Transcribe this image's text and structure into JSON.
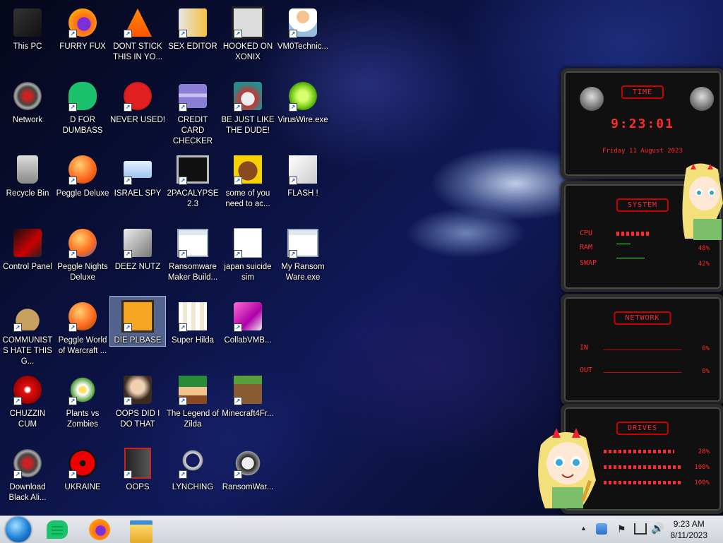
{
  "icons": [
    {
      "label": "This PC",
      "col": 0,
      "row": 0,
      "icon": "this-pc-icon"
    },
    {
      "label": "FURRY FUX",
      "col": 1,
      "row": 0,
      "icon": "firefox-icon"
    },
    {
      "label": "DONT STICK THIS IN YO...",
      "col": 2,
      "row": 0,
      "icon": "vlc-cone-icon"
    },
    {
      "label": "SEX EDITOR",
      "col": 3,
      "row": 0,
      "icon": "hxd-icon"
    },
    {
      "label": "HOOKED ON XONIX",
      "col": 4,
      "row": 0,
      "icon": "xonix-icon"
    },
    {
      "label": "VM0Technic...",
      "col": 5,
      "row": 0,
      "icon": "doctor-icon"
    },
    {
      "label": "Network",
      "col": 0,
      "row": 1,
      "icon": "alien-network-icon"
    },
    {
      "label": "D FOR DUMBASS",
      "col": 1,
      "row": 1,
      "icon": "d-app-icon"
    },
    {
      "label": "NEVER USED!",
      "col": 2,
      "row": 1,
      "icon": "dev-cpp-icon"
    },
    {
      "label": "CREDIT CARD CHECKER",
      "col": 3,
      "row": 1,
      "icon": "credit-card-icon"
    },
    {
      "label": "BE JUST LIKE THE DUDE!",
      "col": 4,
      "row": 1,
      "icon": "santa-icon"
    },
    {
      "label": "VirusWire.exe",
      "col": 5,
      "row": 1,
      "icon": "lime-icon"
    },
    {
      "label": "Recycle Bin",
      "col": 0,
      "row": 2,
      "icon": "recycle-bin-icon"
    },
    {
      "label": "Peggle Deluxe",
      "col": 1,
      "row": 2,
      "icon": "peggle-icon"
    },
    {
      "label": "ISRAEL SPY",
      "col": 2,
      "row": 2,
      "icon": "network-share-icon"
    },
    {
      "label": "2PACALYPSE 2.3",
      "col": 3,
      "row": 2,
      "icon": "terminal-icon"
    },
    {
      "label": "some of you need to ac...",
      "col": 4,
      "row": 2,
      "icon": "dog-icon"
    },
    {
      "label": "FLASH !",
      "col": 5,
      "row": 2,
      "icon": "flash-icon"
    },
    {
      "label": "Control Panel",
      "col": 0,
      "row": 3,
      "icon": "control-panel-icon"
    },
    {
      "label": "Peggle Nights Deluxe",
      "col": 1,
      "row": 3,
      "icon": "peggle-nights-icon"
    },
    {
      "label": "DEEZ NUTZ",
      "col": 2,
      "row": 3,
      "icon": "stack-windows-icon"
    },
    {
      "label": "Ransomware Maker Build...",
      "col": 3,
      "row": 3,
      "icon": "window-app-icon"
    },
    {
      "label": "japan suicide sim",
      "col": 4,
      "row": 3,
      "icon": "document-icon"
    },
    {
      "label": "My Ransom Ware.exe",
      "col": 5,
      "row": 3,
      "icon": "window-app-icon"
    },
    {
      "label": "COMMUNISTS HATE THIS G...",
      "col": 0,
      "row": 4,
      "icon": "money-bag-icon"
    },
    {
      "label": "Peggle World of Warcraft ...",
      "col": 1,
      "row": 4,
      "icon": "peggle-wow-icon"
    },
    {
      "label": "DIE PLBASE",
      "col": 2,
      "row": 4,
      "icon": "dreamweaver-icon",
      "selected": true
    },
    {
      "label": "Super Hilda",
      "col": 3,
      "row": 4,
      "icon": "pixel-hilda-icon"
    },
    {
      "label": "CollabVMB...",
      "col": 4,
      "row": 4,
      "icon": "collabvm-icon"
    },
    {
      "label": "CHUZZIN CUM",
      "col": 0,
      "row": 5,
      "icon": "chuzzle-icon"
    },
    {
      "label": "Plants vs Zombies",
      "col": 1,
      "row": 5,
      "icon": "flower-icon"
    },
    {
      "label": "OOPS DID I DO THAT",
      "col": 2,
      "row": 5,
      "icon": "portrait-icon"
    },
    {
      "label": "The Legend of Zilda",
      "col": 3,
      "row": 5,
      "icon": "zelda-icon"
    },
    {
      "label": "Minecraft4Fr...",
      "col": 4,
      "row": 5,
      "icon": "minecraft-icon"
    },
    {
      "label": "Download Black Ali...",
      "col": 0,
      "row": 6,
      "icon": "alien-icon"
    },
    {
      "label": "UKRAINE",
      "col": 1,
      "row": 6,
      "icon": "radiation-icon"
    },
    {
      "label": "OOPS",
      "col": 2,
      "row": 6,
      "icon": "book-icon"
    },
    {
      "label": "LYNCHING",
      "col": 3,
      "row": 6,
      "icon": "rope-icon"
    },
    {
      "label": "RansomWar...",
      "col": 4,
      "row": 6,
      "icon": "skull-icon"
    }
  ],
  "gadget": {
    "time": {
      "title": "TIME",
      "clock": "9:23:01",
      "date": "Friday 11 August 2023"
    },
    "system": {
      "title": "SYSTEM",
      "cpu_label": "CPU",
      "ram_label": "RAM",
      "swap_label": "SWAP",
      "ram_value": "48%",
      "swap_value": "42%"
    },
    "network": {
      "title": "NETWORK",
      "in_label": "IN",
      "out_label": "OUT",
      "in_value": "0%",
      "out_value": "0%"
    },
    "drives": {
      "title": "DRIVES",
      "values": [
        "28%",
        "100%",
        "100%"
      ]
    }
  },
  "taskbar": {
    "time": "9:23 AM",
    "date": "8/11/2023",
    "pinned": [
      "d-app-icon",
      "firefox-icon",
      "file-explorer-icon"
    ]
  },
  "colors": {
    "accent_red": "#ff2a2a",
    "selection": "#aac8f0"
  }
}
